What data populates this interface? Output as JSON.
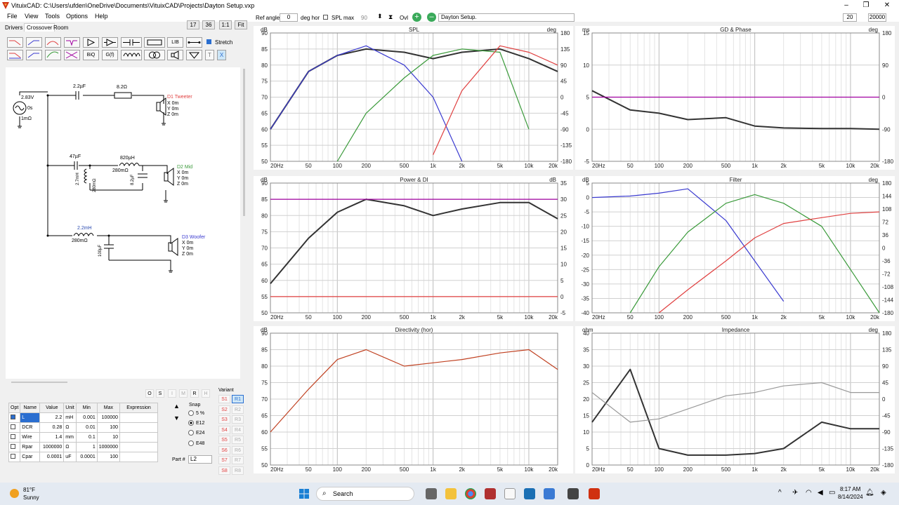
{
  "window": {
    "title": "VituixCAD: C:\\Users\\ufden\\OneDrive\\Documents\\VituixCAD\\Projects\\Dayton Setup.vxp",
    "app_icon": "vituixcad-logo-icon",
    "buttons": {
      "minimize": "–",
      "maximize": "❐",
      "close": "✕"
    }
  },
  "menu": [
    "File",
    "View",
    "Tools",
    "Options",
    "Help"
  ],
  "left_toolbar": {
    "zoom_a": "17",
    "zoom_b": "36",
    "ratio": "1:1",
    "fit": "Fit",
    "tabs": [
      "Drivers",
      "Crossover",
      "Room"
    ],
    "stretch_label": "Stretch",
    "lib": "LIB",
    "biq": "BiQ",
    "gf": "G(f)",
    "t": "T",
    "x": "X"
  },
  "top_toolbar": {
    "ref_angle_label": "Ref angle",
    "ref_angle_value": "0",
    "deg_hor": "deg hor",
    "spl_max_label": "SPL max",
    "spl_max_value": "90",
    "ovl_label": "Ovl",
    "project_name": "Dayton Setup.",
    "freq_min": "20",
    "freq_max": "20000"
  },
  "schematic": {
    "source": {
      "voltage": "2.83V",
      "phase": "0s",
      "resistance": "1mΩ"
    },
    "tweeter": {
      "cap": "2.2µF",
      "res": "8.2Ω",
      "name": "D1 Tweeter",
      "x": "X 0m",
      "y": "Y 0m",
      "z": "Z 0m"
    },
    "mid": {
      "cap": "47µF",
      "ind": "820µH",
      "ind_r": "280mΩ",
      "shunt_l": "2.7mH",
      "shunt_lr": "280mΩ",
      "shunt_c": "8.2µF",
      "name": "D2 Mid",
      "x": "X 0m",
      "y": "Y 0m",
      "z": "Z 0m"
    },
    "woofer": {
      "ind": "2.2mH",
      "ind_r": "280mΩ",
      "cap": "100µF",
      "name": "D3 Woofer",
      "x": "X 0m",
      "y": "Y 0m",
      "z": "Z 0m"
    }
  },
  "part_table": {
    "headers": [
      "Opt",
      "Name",
      "Value",
      "Unit",
      "Min",
      "Max",
      "Expression"
    ],
    "rows": [
      [
        "L",
        "2.2",
        "mH",
        "0.001",
        "100000",
        ""
      ],
      [
        "DCR",
        "0.28",
        "Ω",
        "0.01",
        "100",
        ""
      ],
      [
        "Wire",
        "1.4",
        "mm",
        "0.1",
        "10",
        ""
      ],
      [
        "Rpar",
        "1000000",
        "Ω",
        "1",
        "1000000",
        ""
      ],
      [
        "Cpar",
        "0.0001",
        "uF",
        "0.0001",
        "100",
        ""
      ]
    ],
    "osi_buttons": [
      "O",
      "S",
      "I",
      "M",
      "R",
      "H"
    ],
    "snap_label": "Snap",
    "snap_options": [
      "5 %",
      "E12",
      "E24",
      "E48"
    ],
    "snap_selected": "E12",
    "part_no_label": "Part #",
    "part_no_value": "L2",
    "variant_label": "Variant",
    "variants_s": [
      "S1",
      "S2",
      "S3",
      "S4",
      "S5",
      "S6",
      "S7",
      "S8"
    ],
    "variants_r": [
      "R1",
      "R2",
      "R3",
      "R4",
      "R5",
      "R6",
      "R7",
      "R8"
    ]
  },
  "x_ticks": [
    "20Hz",
    "50",
    "100",
    "200",
    "500",
    "1k",
    "2k",
    "5k",
    "10k",
    "20k"
  ],
  "graphs": [
    {
      "id": "spl",
      "title": "SPL",
      "left_unit": "dB",
      "right_unit": "deg",
      "left_ticks": [
        "90",
        "85",
        "80",
        "75",
        "70",
        "65",
        "60",
        "55",
        "50"
      ],
      "right_ticks": [
        "180",
        "135",
        "90",
        "45",
        "0",
        "-45",
        "-90",
        "-135",
        "-180"
      ]
    },
    {
      "id": "gd",
      "title": "GD & Phase",
      "left_unit": "ms",
      "right_unit": "deg",
      "left_ticks": [
        "15",
        "10",
        "5",
        "0",
        "-5"
      ],
      "right_ticks": [
        "180",
        "90",
        "0",
        "-90",
        "-180"
      ]
    },
    {
      "id": "power",
      "title": "Power & DI",
      "left_unit": "dB",
      "right_unit": "dB",
      "left_ticks": [
        "90",
        "85",
        "80",
        "75",
        "70",
        "65",
        "60",
        "55",
        "50"
      ],
      "right_ticks": [
        "35",
        "30",
        "25",
        "20",
        "15",
        "10",
        "5",
        "0",
        "-5"
      ]
    },
    {
      "id": "filter",
      "title": "Filter",
      "left_unit": "dB",
      "right_unit": "deg",
      "left_ticks": [
        "5",
        "0",
        "-5",
        "-10",
        "-15",
        "-20",
        "-25",
        "-30",
        "-35",
        "-40"
      ],
      "right_ticks": [
        "180",
        "144",
        "108",
        "72",
        "36",
        "0",
        "-36",
        "-72",
        "-108",
        "-144",
        "-180"
      ]
    },
    {
      "id": "directivity",
      "title": "Directivity (hor)",
      "left_unit": "dB",
      "right_unit": "",
      "left_ticks": [
        "90",
        "85",
        "80",
        "75",
        "70",
        "65",
        "60",
        "55",
        "50"
      ],
      "right_ticks": []
    },
    {
      "id": "impedance",
      "title": "Impedance",
      "left_unit": "ohm",
      "right_unit": "deg",
      "left_ticks": [
        "40",
        "35",
        "30",
        "25",
        "20",
        "15",
        "10",
        "5",
        "0"
      ],
      "right_ticks": [
        "180",
        "135",
        "90",
        "45",
        "0",
        "-45",
        "-90",
        "-135",
        "-180"
      ]
    }
  ],
  "chart_data": [
    {
      "type": "line",
      "title": "SPL",
      "ylabel": "dB",
      "ylim": [
        50,
        90
      ],
      "x": [
        20,
        50,
        100,
        200,
        500,
        1000,
        2000,
        5000,
        10000,
        20000
      ],
      "series": [
        {
          "color": "#333333",
          "values": [
            60,
            78,
            83,
            85,
            84,
            82,
            84,
            85,
            82,
            78
          ]
        },
        {
          "color": "#3a3ad0",
          "values": [
            60,
            78,
            83,
            86,
            80,
            70,
            50,
            null,
            null,
            null
          ]
        },
        {
          "color": "#3a9a3a",
          "values": [
            null,
            null,
            50,
            65,
            76,
            83,
            85,
            84,
            60,
            null
          ]
        },
        {
          "color": "#e04040",
          "values": [
            null,
            null,
            null,
            null,
            null,
            52,
            72,
            86,
            84,
            80
          ]
        }
      ]
    },
    {
      "type": "line",
      "title": "GD & Phase",
      "ylabel": "ms",
      "ylim": [
        -5,
        15
      ],
      "x": [
        20,
        50,
        100,
        200,
        500,
        1000,
        2000,
        5000,
        10000,
        20000
      ],
      "series": [
        {
          "color": "#333333",
          "values": [
            6,
            3,
            2.5,
            1.5,
            1.8,
            0.5,
            0.2,
            0.1,
            0.1,
            0
          ]
        },
        {
          "color": "#a000a0",
          "values": [
            5,
            5,
            5,
            5,
            5,
            5,
            5,
            5,
            5,
            5
          ]
        }
      ]
    },
    {
      "type": "line",
      "title": "Power & DI",
      "ylabel": "dB",
      "ylim": [
        50,
        90
      ],
      "x": [
        20,
        50,
        100,
        200,
        500,
        1000,
        2000,
        5000,
        10000,
        20000
      ],
      "series": [
        {
          "color": "#333333",
          "values": [
            59,
            73,
            81,
            85,
            83,
            80,
            82,
            84,
            84,
            79
          ]
        },
        {
          "color": "#e04040",
          "values": [
            55,
            55,
            55,
            55,
            55,
            55,
            55,
            55,
            55,
            55
          ]
        },
        {
          "color": "#a000a0",
          "values": [
            85,
            85,
            85,
            85,
            85,
            85,
            85,
            85,
            85,
            85
          ]
        }
      ]
    },
    {
      "type": "line",
      "title": "Filter",
      "ylabel": "dB",
      "ylim": [
        -40,
        5
      ],
      "x": [
        20,
        50,
        100,
        200,
        500,
        1000,
        2000,
        5000,
        10000,
        20000
      ],
      "series": [
        {
          "color": "#3a3ad0",
          "values": [
            0,
            0.5,
            1.5,
            3,
            -8,
            -22,
            -36,
            null,
            null,
            null
          ]
        },
        {
          "color": "#3a9a3a",
          "values": [
            null,
            -40,
            -24,
            -12,
            -2,
            1,
            -2,
            -10,
            -25,
            -40
          ]
        },
        {
          "color": "#e04040",
          "values": [
            null,
            null,
            -40,
            -32,
            -22,
            -14,
            -9,
            -7,
            -5.5,
            -5
          ]
        }
      ]
    },
    {
      "type": "line",
      "title": "Directivity (hor)",
      "ylabel": "dB",
      "ylim": [
        50,
        90
      ],
      "x": [
        20,
        50,
        100,
        200,
        500,
        1000,
        2000,
        5000,
        10000,
        20000
      ],
      "series": [
        {
          "color": "#c04020",
          "values": [
            60,
            73,
            82,
            85,
            80,
            81,
            82,
            84,
            85,
            79
          ]
        }
      ]
    },
    {
      "type": "line",
      "title": "Impedance",
      "ylabel": "ohm",
      "ylim": [
        0,
        40
      ],
      "x": [
        20,
        50,
        100,
        200,
        500,
        1000,
        2000,
        5000,
        10000,
        20000
      ],
      "series": [
        {
          "color": "#333333",
          "values": [
            13,
            29,
            5,
            3,
            3,
            3.5,
            5,
            13,
            11,
            11
          ]
        },
        {
          "color": "#999999",
          "values": [
            22,
            13,
            14,
            17,
            21,
            22,
            24,
            25,
            22,
            22
          ]
        }
      ]
    }
  ],
  "colors": {
    "magenta": "#a000a0",
    "red": "#e04040",
    "green": "#3a9a3a",
    "blue": "#3a3ad0",
    "dark": "#333333",
    "grey": "#999999"
  },
  "taskbar": {
    "temperature": "81°F",
    "weather": "Sunny",
    "search": "Search",
    "time": "8:17 AM",
    "date": "8/14/2024"
  }
}
